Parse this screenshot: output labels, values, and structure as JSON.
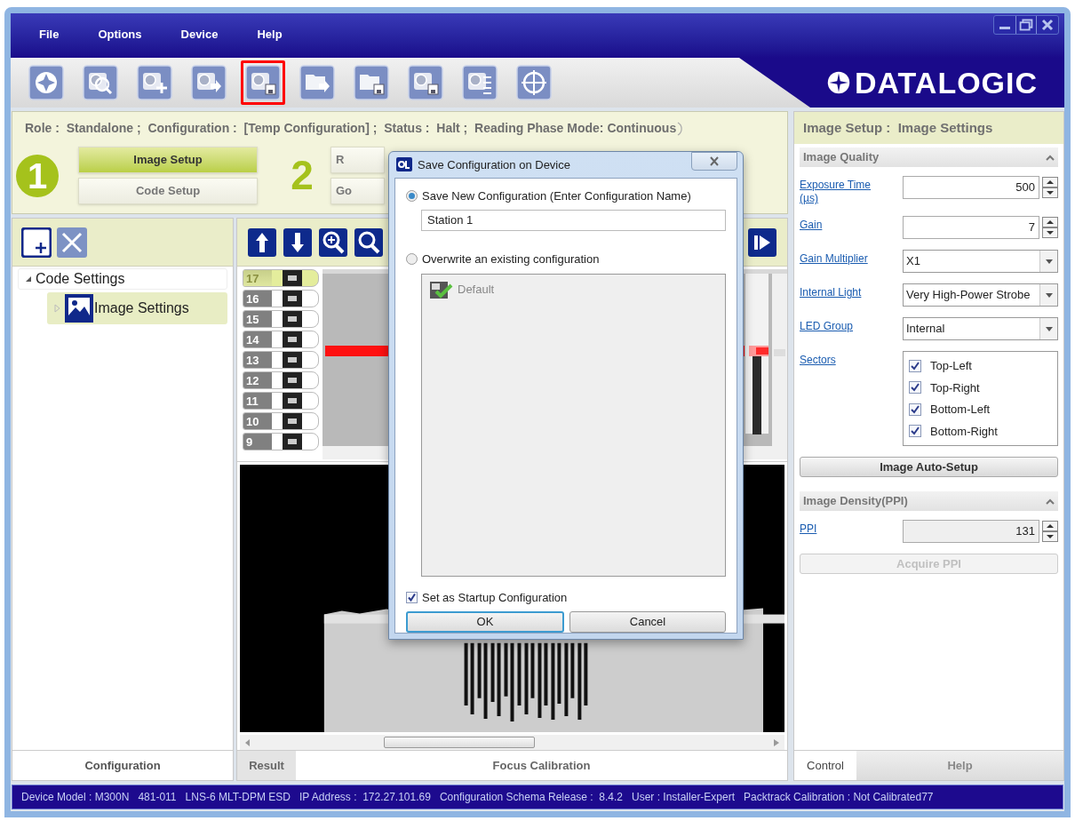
{
  "logo": "DATALOGIC",
  "menu": [
    {
      "label": "File"
    },
    {
      "label": "Options"
    },
    {
      "label": "Device"
    },
    {
      "label": "Help"
    }
  ],
  "toolbar": [
    {
      "kind": "target",
      "selected": false
    },
    {
      "kind": "camera-search",
      "selected": false
    },
    {
      "kind": "camera-add",
      "selected": false
    },
    {
      "kind": "camera-send",
      "selected": false
    },
    {
      "kind": "camera-save",
      "selected": true
    },
    {
      "kind": "folder-send",
      "selected": false
    },
    {
      "kind": "folder-save",
      "selected": false
    },
    {
      "kind": "camera-save",
      "selected": false
    },
    {
      "kind": "camera-list",
      "selected": false
    },
    {
      "kind": "crosshair",
      "selected": false
    }
  ],
  "status_line": "Role :  Standalone ;  Configuration :  [Temp Configuration] ;  Status :  Halt ;  Reading Phase Mode: Continuous",
  "steps": [
    {
      "number": "1",
      "selected": true,
      "buttons": [
        {
          "label": "Image Setup",
          "selected": true
        },
        {
          "label": "Code Setup",
          "selected": false
        }
      ]
    },
    {
      "number": "2",
      "selected": false,
      "buttons": [
        {
          "label": "R",
          "selected": false
        },
        {
          "label": "Go",
          "selected": false
        }
      ]
    }
  ],
  "configuration_panel": {
    "tree": [
      {
        "label": "Code Settings",
        "expanded": true,
        "selected": false,
        "children": [
          {
            "label": "Image Settings",
            "expanded": false,
            "selected": true
          }
        ]
      }
    ],
    "tab": "Configuration"
  },
  "focus_panel": {
    "strip": [
      {
        "number": "17",
        "selected": true
      },
      {
        "number": "16",
        "selected": false
      },
      {
        "number": "15",
        "selected": false
      },
      {
        "number": "14",
        "selected": false
      },
      {
        "number": "13",
        "selected": false
      },
      {
        "number": "12",
        "selected": false
      },
      {
        "number": "11",
        "selected": false
      },
      {
        "number": "10",
        "selected": false
      },
      {
        "number": "9",
        "selected": false
      }
    ],
    "tab": "Result",
    "title": "Focus Calibration"
  },
  "dialog": {
    "title": "Save Configuration on Device",
    "options": [
      {
        "label": "Save New Configuration (Enter Configuration Name)",
        "selected": true
      },
      {
        "label": "Overwrite an existing configuration",
        "selected": false
      }
    ],
    "name_value": "Station 1",
    "configurations": [
      {
        "label": "Default"
      }
    ],
    "startup": {
      "label": "Set as Startup Configuration",
      "checked": true
    },
    "buttons": [
      {
        "label": "OK",
        "focused": true
      },
      {
        "label": "Cancel",
        "focused": false
      }
    ]
  },
  "settings_panel": {
    "title": "Image Setup :  Image Settings",
    "sections": [
      {
        "title": "Image Quality",
        "expanded": true,
        "rows": [
          {
            "kind": "spin",
            "label": "Exposure Time (µs)",
            "value": "500",
            "disabled": false
          },
          {
            "kind": "spin",
            "label": "Gain",
            "value": "7",
            "disabled": false
          },
          {
            "kind": "select",
            "label": "Gain Multiplier",
            "value": "X1"
          },
          {
            "kind": "select",
            "label": "Internal Light",
            "value": "Very High-Power Strobe"
          },
          {
            "kind": "select",
            "label": "LED Group",
            "value": "Internal"
          },
          {
            "kind": "checklist",
            "label": "Sectors",
            "items": [
              {
                "label": "Top-Left",
                "checked": true
              },
              {
                "label": "Top-Right",
                "checked": true
              },
              {
                "label": "Bottom-Left",
                "checked": true
              },
              {
                "label": "Bottom-Right",
                "checked": true
              }
            ]
          },
          {
            "kind": "button",
            "label": "Image Auto-Setup",
            "disabled": false
          }
        ]
      },
      {
        "title": "Image Density(PPI)",
        "expanded": true,
        "rows": [
          {
            "kind": "spin",
            "label": "PPI",
            "value": "131",
            "disabled": true
          },
          {
            "kind": "button",
            "label": "Acquire PPI",
            "disabled": true
          }
        ]
      }
    ],
    "tabs": [
      {
        "label": "Control",
        "selected": true
      },
      {
        "label": "Help",
        "selected": false
      }
    ]
  },
  "status_bar": "Device Model : M300N   481-011   LNS-6 MLT-DPM ESD   IP Address :  172.27.101.69   Configuration Schema Release :  8.4.2   User : Installer-Expert   Packtrack Calibration : Not Calibrated77"
}
